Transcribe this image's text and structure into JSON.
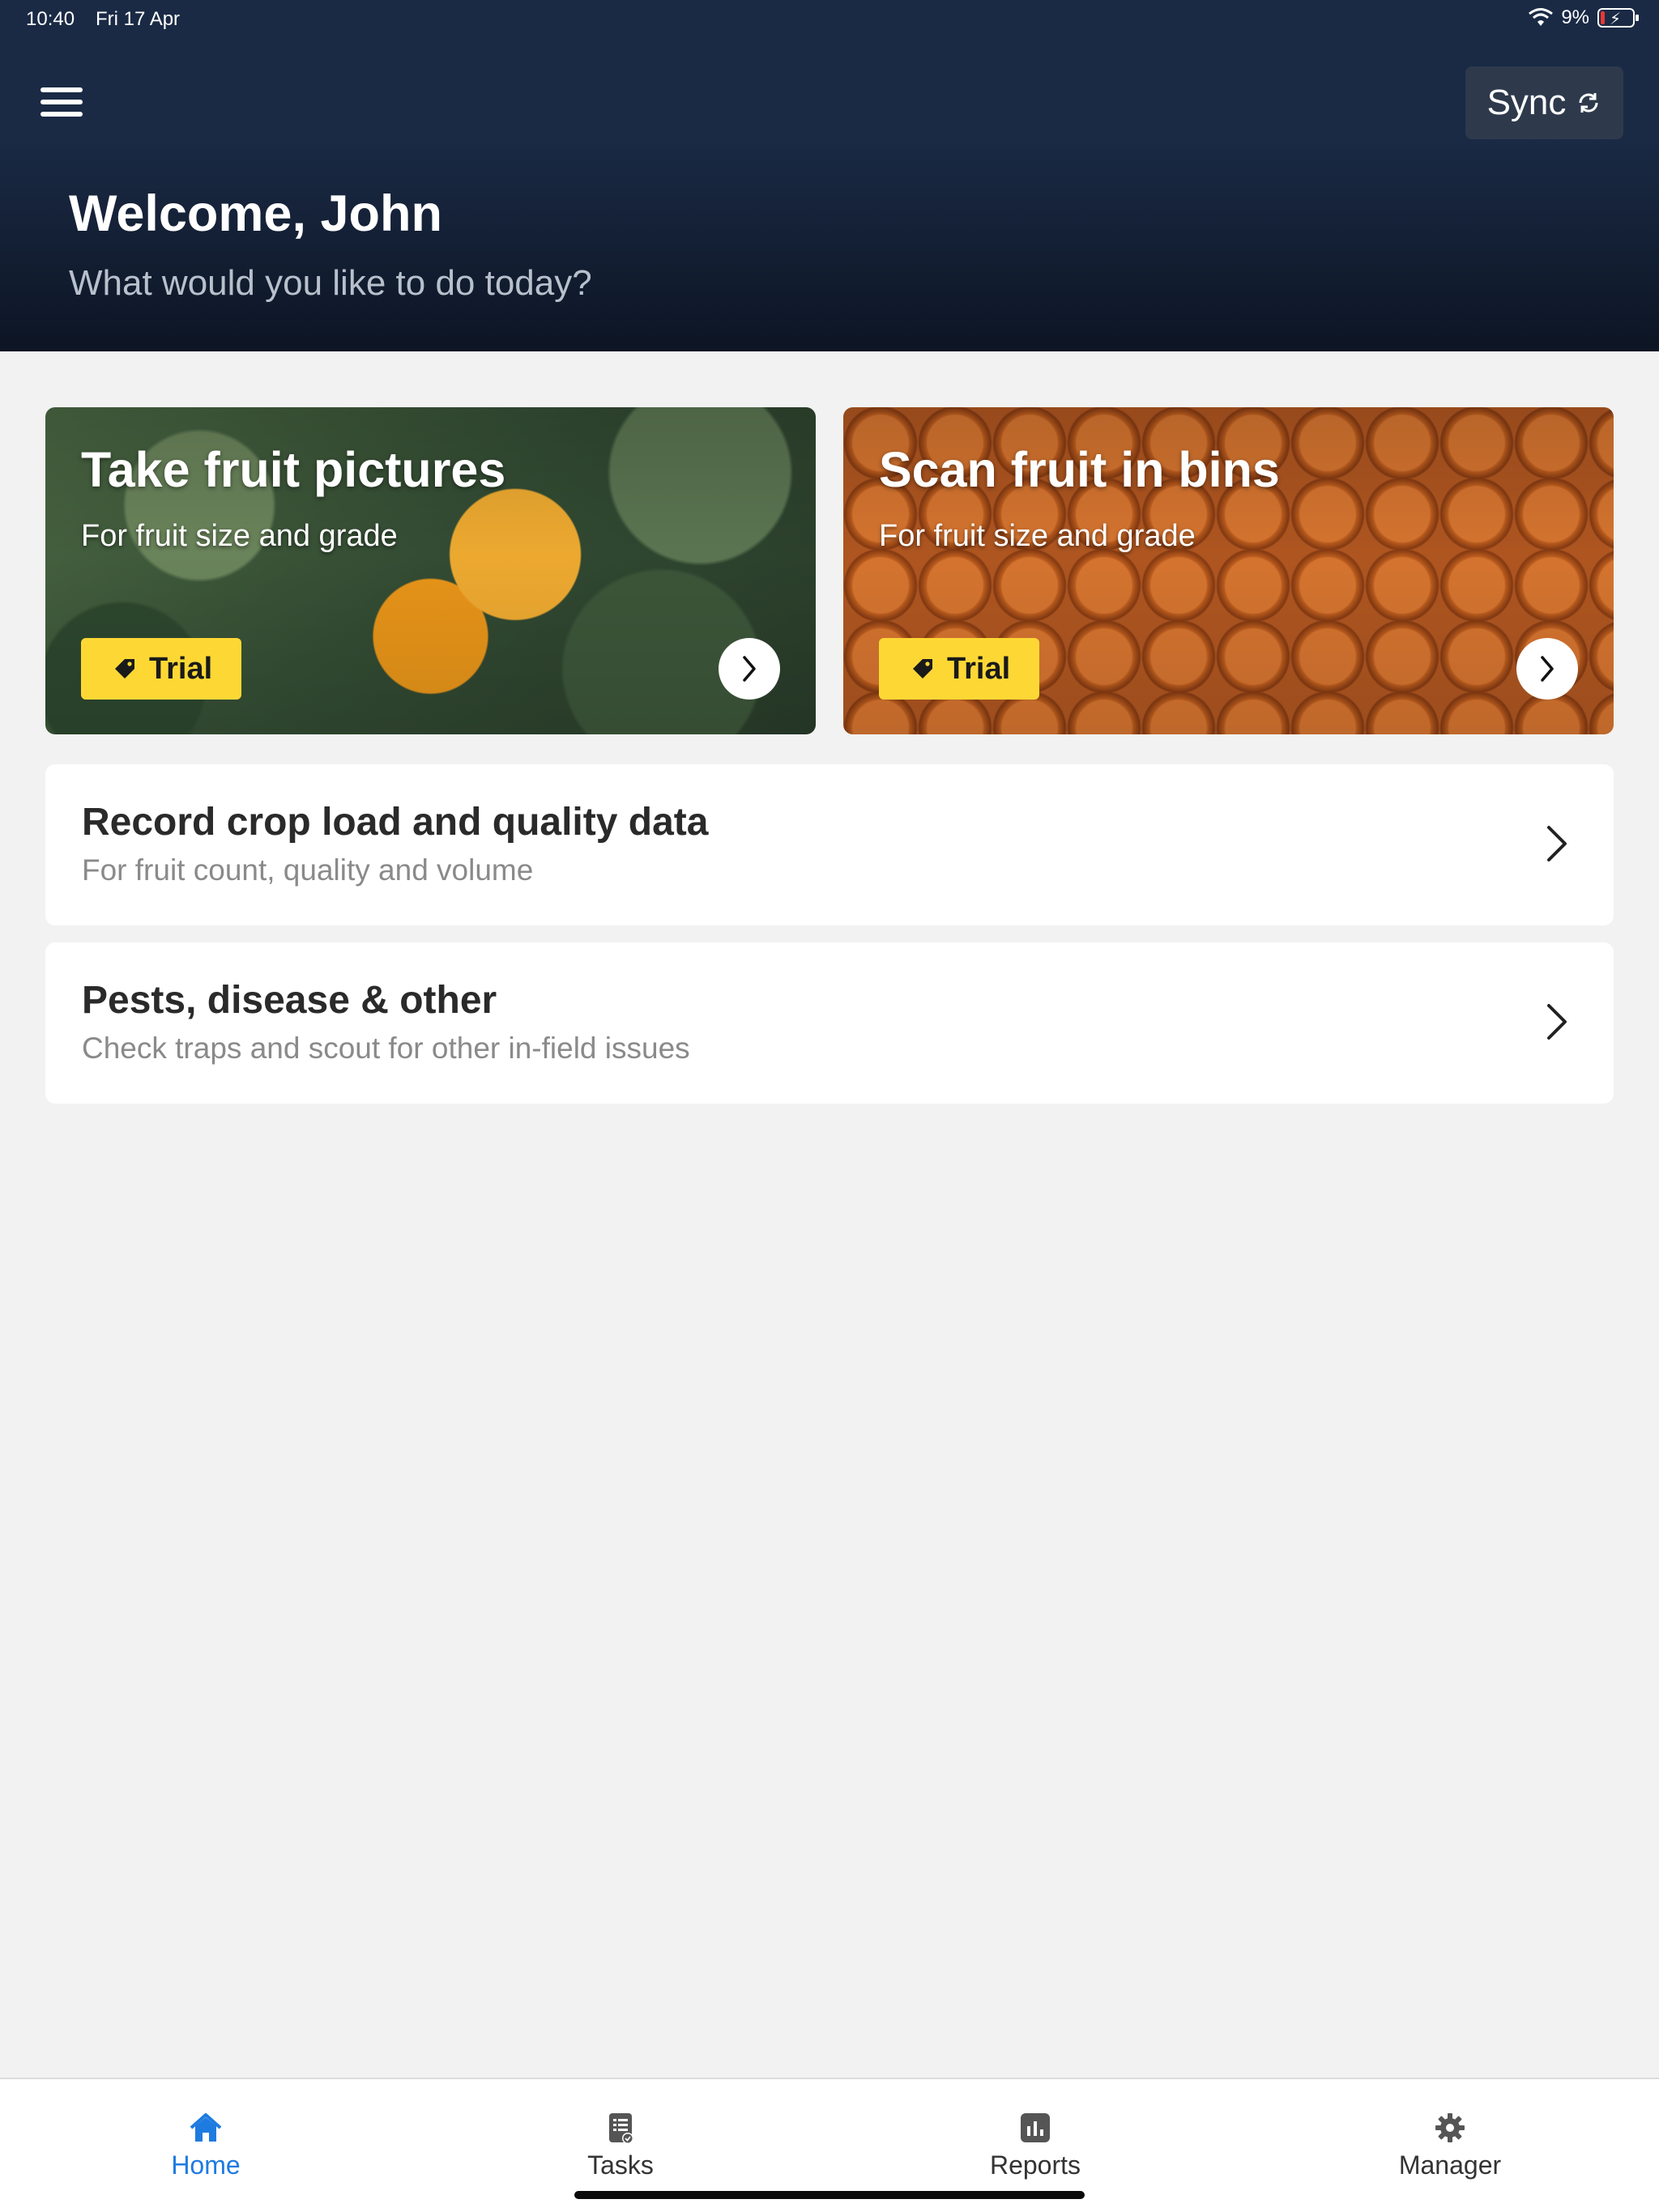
{
  "status_bar": {
    "time": "10:40",
    "date": "Fri 17 Apr",
    "battery_percent": "9%",
    "battery_level": 0.09,
    "wifi_icon": "wifi-icon",
    "battery_icon": "battery-charging-icon"
  },
  "header": {
    "menu_icon": "hamburger-menu-icon",
    "sync_label": "Sync",
    "sync_icon": "refresh-icon",
    "welcome": "Welcome, John",
    "subtitle": "What would you like to do today?"
  },
  "feature_cards": [
    {
      "title": "Take fruit pictures",
      "subtitle": "For fruit size and grade",
      "badge": "Trial",
      "badge_icon": "tag-icon",
      "arrow_icon": "chevron-right-icon"
    },
    {
      "title": "Scan fruit in bins",
      "subtitle": "For fruit size and grade",
      "badge": "Trial",
      "badge_icon": "tag-icon",
      "arrow_icon": "chevron-right-icon"
    }
  ],
  "list_cards": [
    {
      "title": "Record crop load and quality data",
      "subtitle": "For fruit count, quality and volume"
    },
    {
      "title": "Pests, disease & other",
      "subtitle": "Check traps and scout for other in-field issues"
    }
  ],
  "bottom_nav": {
    "items": [
      {
        "label": "Home",
        "icon": "home-icon",
        "active": true
      },
      {
        "label": "Tasks",
        "icon": "tasks-icon",
        "active": false
      },
      {
        "label": "Reports",
        "icon": "reports-icon",
        "active": false
      },
      {
        "label": "Manager",
        "icon": "gear-icon",
        "active": false
      }
    ]
  },
  "colors": {
    "header_bg": "#1a2a45",
    "accent": "#1e7be0",
    "badge": "#fdd835",
    "page_bg": "#f2f2f2"
  }
}
